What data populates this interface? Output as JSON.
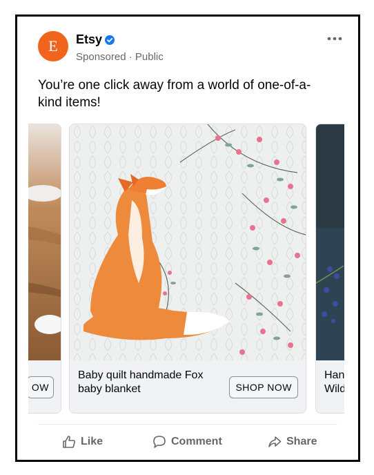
{
  "post": {
    "page_name": "Etsy",
    "avatar_letter": "E",
    "sponsored": "Sponsored",
    "separator": "·",
    "audience": "Public",
    "caption": "You’re one click away from a world of one-of-a-kind items!",
    "verified": true
  },
  "carousel": {
    "cards": [
      {
        "title": "",
        "button": "OW"
      },
      {
        "title": "Baby quilt handmade Fox baby blanket",
        "button": "SHOP NOW"
      },
      {
        "title": "Han Wild",
        "button": ""
      }
    ]
  },
  "actions": {
    "like": "Like",
    "comment": "Comment",
    "share": "Share"
  },
  "colors": {
    "brand": "#f1641e",
    "verified": "#1877f2",
    "muted_text": "#65676b"
  },
  "icons": [
    "verified-badge-icon",
    "more-options-icon",
    "like-icon",
    "comment-icon",
    "share-icon"
  ]
}
